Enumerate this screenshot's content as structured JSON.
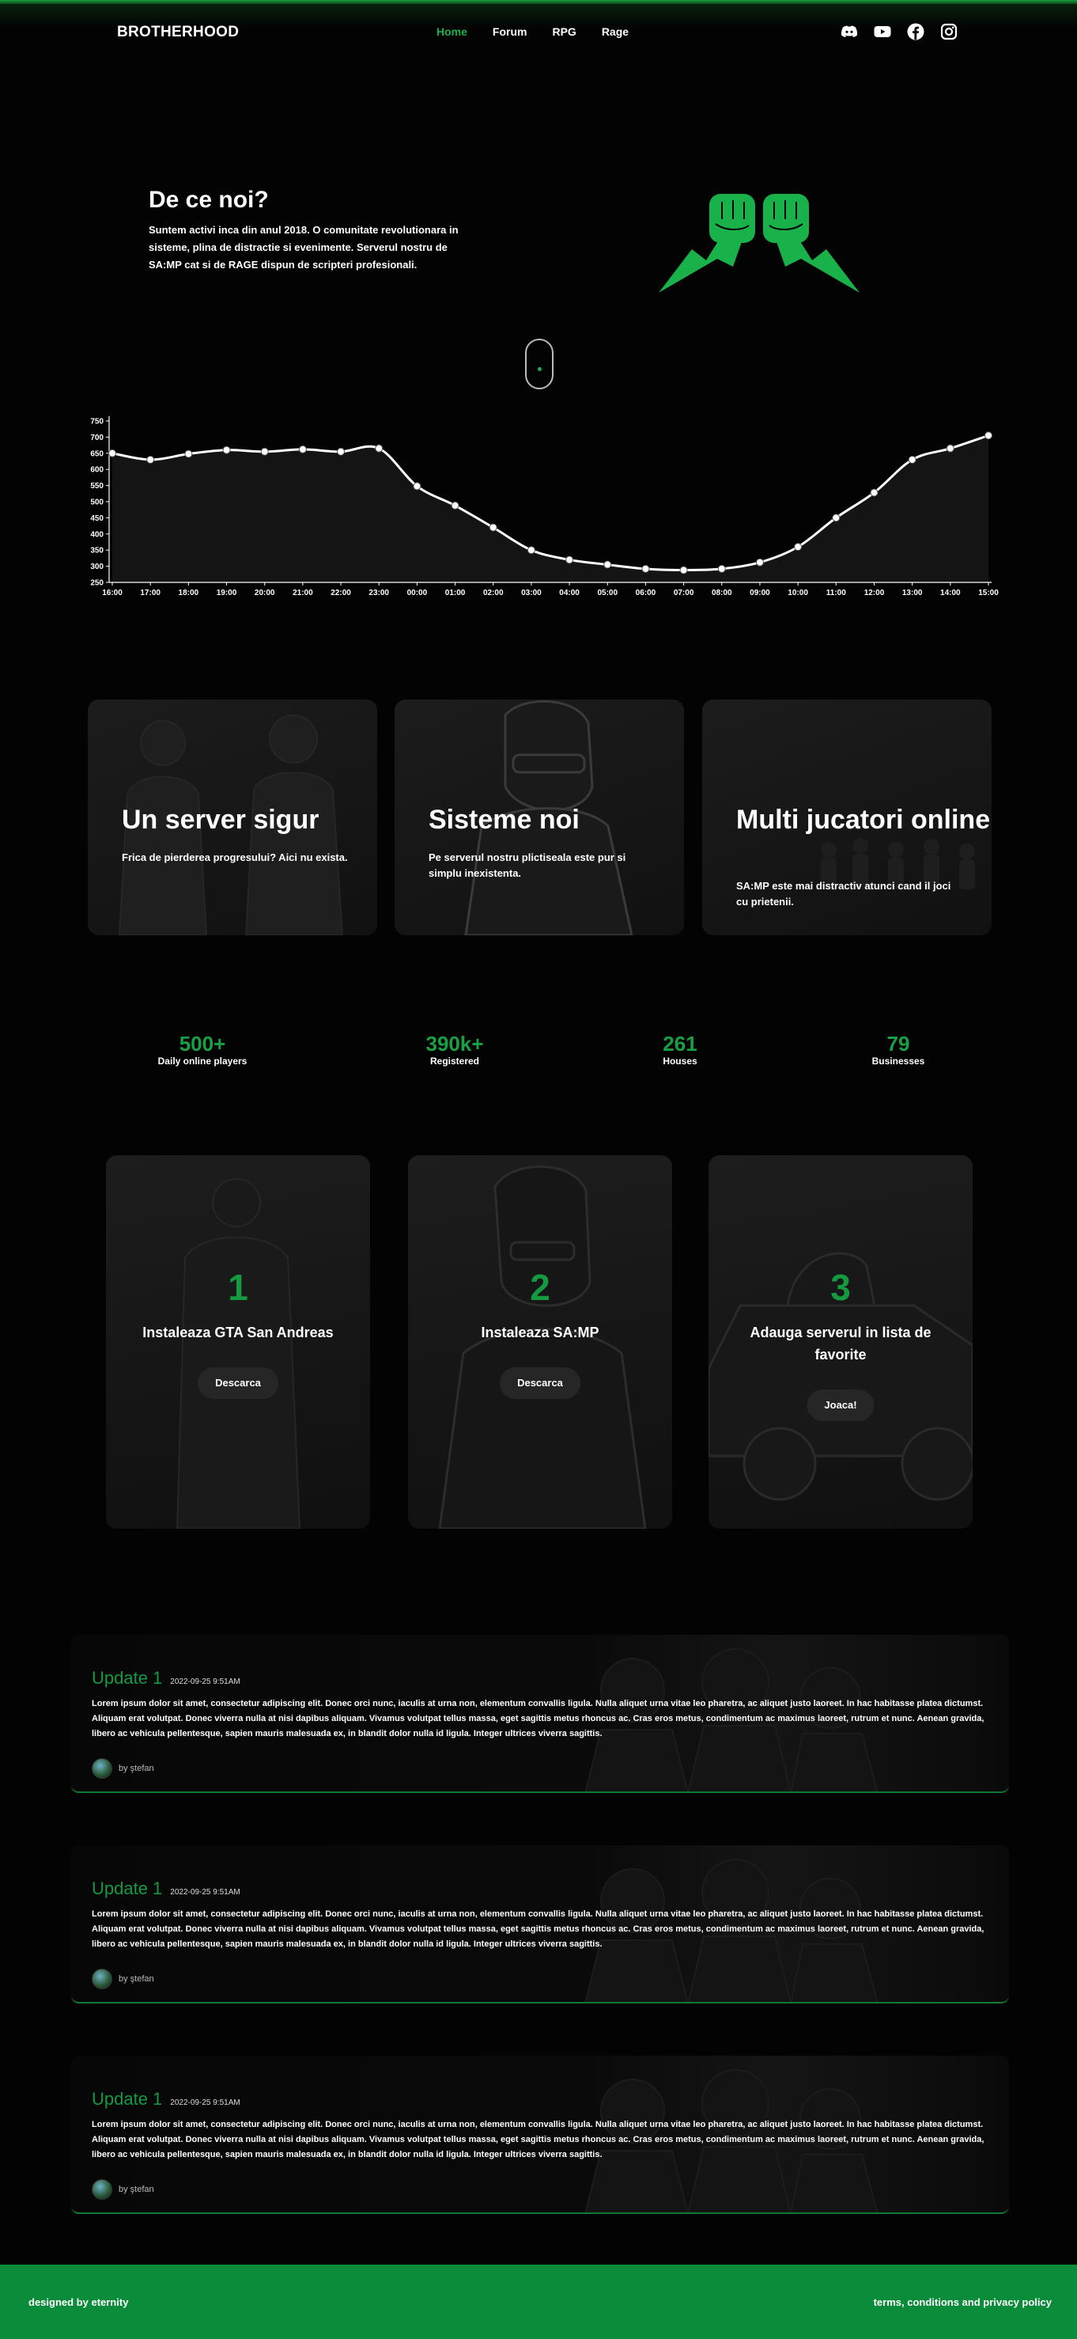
{
  "nav": {
    "brand": "BROTHERHOOD",
    "links": [
      {
        "label": "Home",
        "active": true
      },
      {
        "label": "Forum",
        "active": false
      },
      {
        "label": "RPG",
        "active": false
      },
      {
        "label": "Rage",
        "active": false
      }
    ],
    "social_icons": [
      "discord-icon",
      "youtube-icon",
      "facebook-icon",
      "instagram-icon"
    ]
  },
  "about": {
    "title": "De ce noi?",
    "text": "Suntem activi inca din anul 2018. O comunitate revolutionara in sisteme, plina de distractie si evenimente. Serverul nostru de SA:MP cat si de RAGE dispun de scripteri profesionali."
  },
  "chart_data": {
    "type": "line",
    "categories": [
      "16:00",
      "17:00",
      "18:00",
      "19:00",
      "20:00",
      "21:00",
      "22:00",
      "23:00",
      "00:00",
      "01:00",
      "02:00",
      "03:00",
      "04:00",
      "05:00",
      "06:00",
      "07:00",
      "08:00",
      "09:00",
      "10:00",
      "11:00",
      "12:00",
      "13:00",
      "14:00",
      "15:00"
    ],
    "values": [
      650,
      630,
      648,
      660,
      655,
      662,
      655,
      665,
      548,
      488,
      420,
      350,
      320,
      305,
      292,
      288,
      292,
      312,
      360,
      450,
      528,
      630,
      665,
      705
    ],
    "ylim": [
      250,
      750
    ],
    "yticks": [
      250,
      300,
      350,
      400,
      450,
      500,
      550,
      600,
      650,
      700,
      750
    ],
    "grid": false,
    "line_color": "#ffffff",
    "fill_color": "#141414"
  },
  "features": [
    {
      "title": "Un server sigur",
      "text": "Frica de pierderea progresului? Aici nu exista."
    },
    {
      "title": "Sisteme noi",
      "text": "Pe serverul nostru plictiseala este pur si simplu inexistenta."
    },
    {
      "title": "Multi jucatori online",
      "text": "SA:MP este mai distractiv atunci cand il joci cu prietenii."
    }
  ],
  "stats": [
    {
      "value": "500+",
      "label": "Daily online players"
    },
    {
      "value": "390k+",
      "label": "Registered"
    },
    {
      "value": "261",
      "label": "Houses"
    },
    {
      "value": "79",
      "label": "Businesses"
    }
  ],
  "steps": [
    {
      "number": "1",
      "title": "Instaleaza GTA San Andreas",
      "button": "Descarca"
    },
    {
      "number": "2",
      "title": "Instaleaza SA:MP",
      "button": "Descarca"
    },
    {
      "number": "3",
      "title": "Adauga serverul in lista de favorite",
      "button": "Joaca!"
    }
  ],
  "updates": [
    {
      "title": "Update 1",
      "date": "2022-09-25 9:51AM",
      "body": "Lorem ipsum dolor sit amet, consectetur adipiscing elit. Donec orci nunc, iaculis at urna non, elementum convallis ligula. Nulla aliquet urna vitae leo pharetra, ac aliquet justo laoreet. In hac habitasse platea dictumst. Aliquam erat volutpat. Donec viverra nulla at nisi dapibus aliquam. Vivamus volutpat tellus massa, eget sagittis metus rhoncus ac. Cras eros metus, condimentum ac maximus laoreet, rutrum et nunc. Aenean gravida, libero ac vehicula pellentesque, sapien mauris malesuada ex, in blandit dolor nulla id ligula. Integer ultrices viverra sagittis.",
      "author": "by ştefan"
    },
    {
      "title": "Update 1",
      "date": "2022-09-25 9:51AM",
      "body": "Lorem ipsum dolor sit amet, consectetur adipiscing elit. Donec orci nunc, iaculis at urna non, elementum convallis ligula. Nulla aliquet urna vitae leo pharetra, ac aliquet justo laoreet. In hac habitasse platea dictumst. Aliquam erat volutpat. Donec viverra nulla at nisi dapibus aliquam. Vivamus volutpat tellus massa, eget sagittis metus rhoncus ac. Cras eros metus, condimentum ac maximus laoreet, rutrum et nunc. Aenean gravida, libero ac vehicula pellentesque, sapien mauris malesuada ex, in blandit dolor nulla id ligula. Integer ultrices viverra sagittis.",
      "author": "by ştefan"
    },
    {
      "title": "Update 1",
      "date": "2022-09-25 9:51AM",
      "body": "Lorem ipsum dolor sit amet, consectetur adipiscing elit. Donec orci nunc, iaculis at urna non, elementum convallis ligula. Nulla aliquet urna vitae leo pharetra, ac aliquet justo laoreet. In hac habitasse platea dictumst. Aliquam erat volutpat. Donec viverra nulla at nisi dapibus aliquam. Vivamus volutpat tellus massa, eget sagittis metus rhoncus ac. Cras eros metus, condimentum ac maximus laoreet, rutrum et nunc. Aenean gravida, libero ac vehicula pellentesque, sapien mauris malesuada ex, in blandit dolor nulla id ligula. Integer ultrices viverra sagittis.",
      "author": "by ştefan"
    }
  ],
  "footer": {
    "left": "designed by eternity",
    "right": "terms, conditions and privacy policy"
  },
  "colors": {
    "accent": "#1db14c",
    "footer": "#0b8c3a",
    "background": "#030303"
  }
}
